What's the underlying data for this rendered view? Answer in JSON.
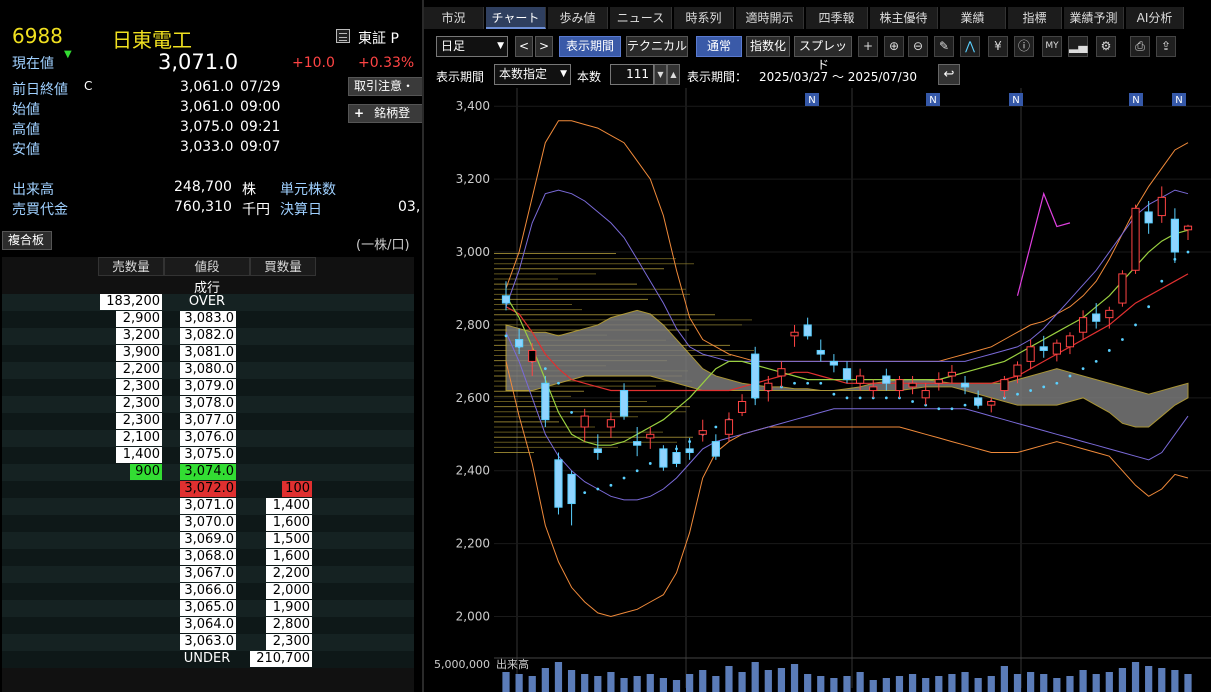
{
  "stock": {
    "code": "6988",
    "name": "日東電工",
    "market": "東証 P",
    "current_label": "現在値",
    "current_arrow": "▼",
    "current_price": "3,071.0",
    "change": "+10.0",
    "change_pct": "+0.33%"
  },
  "summary": [
    {
      "label": "前日終値",
      "flag": "C",
      "value": "3,061.0",
      "time": "07/29"
    },
    {
      "label": "始値",
      "flag": "",
      "value": "3,061.0",
      "time": "09:00"
    },
    {
      "label": "高値",
      "flag": "",
      "value": "3,075.0",
      "time": "09:21"
    },
    {
      "label": "安値",
      "flag": "",
      "value": "3,033.0",
      "time": "09:07"
    }
  ],
  "volume": {
    "label": "出来高",
    "value": "248,700",
    "unit": "株",
    "unit_label": "単元株数"
  },
  "turnover": {
    "label": "売買代金",
    "value": "760,310",
    "unit": "千円",
    "settle_label": "決算日",
    "settle_value": "03,"
  },
  "side_buttons": {
    "caution": "取引注意・",
    "register": "銘柄登",
    "plus": "+"
  },
  "board": {
    "title": "複合板",
    "unit_note": "(一株/口)",
    "headers": [
      "売数量",
      "値段",
      "買数量"
    ],
    "market_order": "成行",
    "rows": [
      {
        "sell": "183,200",
        "price": "OVER",
        "buy": ""
      },
      {
        "sell": "2,900",
        "price": "3,083.0",
        "buy": ""
      },
      {
        "sell": "3,200",
        "price": "3,082.0",
        "buy": ""
      },
      {
        "sell": "3,900",
        "price": "3,081.0",
        "buy": ""
      },
      {
        "sell": "2,200",
        "price": "3,080.0",
        "buy": ""
      },
      {
        "sell": "2,300",
        "price": "3,079.0",
        "buy": ""
      },
      {
        "sell": "2,300",
        "price": "3,078.0",
        "buy": ""
      },
      {
        "sell": "2,300",
        "price": "3,077.0",
        "buy": ""
      },
      {
        "sell": "2,100",
        "price": "3,076.0",
        "buy": ""
      },
      {
        "sell": "1,400",
        "price": "3,075.0",
        "buy": ""
      },
      {
        "sell": "900",
        "price": "3,074.0",
        "buy": ""
      },
      {
        "sell": "",
        "price": "3,072.0",
        "buy": "100"
      },
      {
        "sell": "",
        "price": "3,071.0",
        "buy": "1,400"
      },
      {
        "sell": "",
        "price": "3,070.0",
        "buy": "1,600"
      },
      {
        "sell": "",
        "price": "3,069.0",
        "buy": "1,500"
      },
      {
        "sell": "",
        "price": "3,068.0",
        "buy": "1,600"
      },
      {
        "sell": "",
        "price": "3,067.0",
        "buy": "2,200"
      },
      {
        "sell": "",
        "price": "3,066.0",
        "buy": "2,000"
      },
      {
        "sell": "",
        "price": "3,065.0",
        "buy": "1,900"
      },
      {
        "sell": "",
        "price": "3,064.0",
        "buy": "2,800"
      },
      {
        "sell": "",
        "price": "3,063.0",
        "buy": "2,300"
      },
      {
        "sell": "",
        "price": "UNDER",
        "buy": "210,700"
      }
    ]
  },
  "tabs": [
    "市況",
    "チャート",
    "歩み値",
    "ニュース",
    "時系列",
    "適時開示",
    "四季報",
    "株主優待",
    "業績",
    "指標",
    "業績予測",
    "AI分析"
  ],
  "active_tab": "チャート",
  "toolbar": {
    "period_select": "日足",
    "prev": "<",
    "next": ">",
    "display_period": "表示期間",
    "technical": "テクニカル",
    "normal": "通常",
    "index": "指数化",
    "spread": "スプレッド"
  },
  "period_bar": {
    "label": "表示期間",
    "mode": "本数指定",
    "count_label": "本数",
    "count": "111",
    "range_label": "表示期間：",
    "range": "2025/03/27 ～ 2025/07/30"
  },
  "news_marker": "N",
  "volume_label": "出来高",
  "volume_tick": "5,000,000",
  "colors": {
    "accent": "#3a5aa8",
    "up": "#ff4444",
    "down": "#5ad0ff",
    "bid_green": "#33dd33",
    "ask_red": "#e03030"
  },
  "chart_data": {
    "type": "candlestick",
    "title": "",
    "xlabel": "",
    "ylabel": "",
    "ylim": [
      1900,
      3450
    ],
    "yticks": [
      "3,400",
      "3,200",
      "3,000",
      "2,800",
      "2,600",
      "2,400",
      "2,200",
      "2,000"
    ],
    "x_range": [
      "2025/03/27",
      "2025/07/30"
    ],
    "candles": [
      {
        "o": 2880,
        "h": 2920,
        "l": 2840,
        "c": 2860,
        "d": 1
      },
      {
        "o": 2760,
        "h": 2790,
        "l": 2720,
        "c": 2740,
        "d": 1
      },
      {
        "o": 2700,
        "h": 2750,
        "l": 2660,
        "c": 2730,
        "d": 0
      },
      {
        "o": 2640,
        "h": 2660,
        "l": 2520,
        "c": 2540,
        "d": 1
      },
      {
        "o": 2430,
        "h": 2450,
        "l": 2280,
        "c": 2300,
        "d": 1
      },
      {
        "o": 2390,
        "h": 2400,
        "l": 2250,
        "c": 2310,
        "d": 1
      },
      {
        "o": 2520,
        "h": 2570,
        "l": 2480,
        "c": 2550,
        "d": 0
      },
      {
        "o": 2460,
        "h": 2500,
        "l": 2430,
        "c": 2450,
        "d": 1
      },
      {
        "o": 2520,
        "h": 2560,
        "l": 2490,
        "c": 2540,
        "d": 0
      },
      {
        "o": 2620,
        "h": 2640,
        "l": 2540,
        "c": 2550,
        "d": 1
      },
      {
        "o": 2480,
        "h": 2520,
        "l": 2440,
        "c": 2470,
        "d": 1
      },
      {
        "o": 2490,
        "h": 2520,
        "l": 2460,
        "c": 2500,
        "d": 0
      },
      {
        "o": 2460,
        "h": 2470,
        "l": 2400,
        "c": 2410,
        "d": 1
      },
      {
        "o": 2450,
        "h": 2470,
        "l": 2410,
        "c": 2420,
        "d": 1
      },
      {
        "o": 2460,
        "h": 2490,
        "l": 2430,
        "c": 2450,
        "d": 1
      },
      {
        "o": 2500,
        "h": 2540,
        "l": 2480,
        "c": 2510,
        "d": 0
      },
      {
        "o": 2480,
        "h": 2500,
        "l": 2430,
        "c": 2440,
        "d": 1
      },
      {
        "o": 2500,
        "h": 2560,
        "l": 2480,
        "c": 2540,
        "d": 0
      },
      {
        "o": 2560,
        "h": 2610,
        "l": 2550,
        "c": 2590,
        "d": 0
      },
      {
        "o": 2720,
        "h": 2740,
        "l": 2580,
        "c": 2600,
        "d": 1
      },
      {
        "o": 2620,
        "h": 2660,
        "l": 2590,
        "c": 2640,
        "d": 0
      },
      {
        "o": 2660,
        "h": 2700,
        "l": 2630,
        "c": 2680,
        "d": 0
      },
      {
        "o": 2770,
        "h": 2800,
        "l": 2740,
        "c": 2780,
        "d": 0
      },
      {
        "o": 2800,
        "h": 2820,
        "l": 2760,
        "c": 2770,
        "d": 1
      },
      {
        "o": 2730,
        "h": 2760,
        "l": 2700,
        "c": 2720,
        "d": 1
      },
      {
        "o": 2700,
        "h": 2720,
        "l": 2670,
        "c": 2690,
        "d": 1
      },
      {
        "o": 2680,
        "h": 2700,
        "l": 2640,
        "c": 2650,
        "d": 1
      },
      {
        "o": 2640,
        "h": 2680,
        "l": 2620,
        "c": 2660,
        "d": 0
      },
      {
        "o": 2620,
        "h": 2650,
        "l": 2600,
        "c": 2630,
        "d": 0
      },
      {
        "o": 2660,
        "h": 2680,
        "l": 2620,
        "c": 2640,
        "d": 1
      },
      {
        "o": 2620,
        "h": 2660,
        "l": 2600,
        "c": 2650,
        "d": 0
      },
      {
        "o": 2630,
        "h": 2660,
        "l": 2610,
        "c": 2640,
        "d": 0
      },
      {
        "o": 2600,
        "h": 2640,
        "l": 2580,
        "c": 2620,
        "d": 0
      },
      {
        "o": 2640,
        "h": 2670,
        "l": 2620,
        "c": 2650,
        "d": 0
      },
      {
        "o": 2660,
        "h": 2690,
        "l": 2640,
        "c": 2670,
        "d": 0
      },
      {
        "o": 2640,
        "h": 2660,
        "l": 2610,
        "c": 2630,
        "d": 1
      },
      {
        "o": 2600,
        "h": 2620,
        "l": 2570,
        "c": 2580,
        "d": 1
      },
      {
        "o": 2580,
        "h": 2600,
        "l": 2560,
        "c": 2590,
        "d": 0
      },
      {
        "o": 2620,
        "h": 2660,
        "l": 2600,
        "c": 2650,
        "d": 0
      },
      {
        "o": 2660,
        "h": 2700,
        "l": 2640,
        "c": 2690,
        "d": 0
      },
      {
        "o": 2700,
        "h": 2760,
        "l": 2680,
        "c": 2740,
        "d": 0
      },
      {
        "o": 2740,
        "h": 2770,
        "l": 2710,
        "c": 2730,
        "d": 1
      },
      {
        "o": 2720,
        "h": 2760,
        "l": 2700,
        "c": 2750,
        "d": 0
      },
      {
        "o": 2740,
        "h": 2780,
        "l": 2720,
        "c": 2770,
        "d": 0
      },
      {
        "o": 2780,
        "h": 2840,
        "l": 2760,
        "c": 2820,
        "d": 0
      },
      {
        "o": 2830,
        "h": 2860,
        "l": 2790,
        "c": 2810,
        "d": 1
      },
      {
        "o": 2820,
        "h": 2850,
        "l": 2790,
        "c": 2840,
        "d": 0
      },
      {
        "o": 2860,
        "h": 2950,
        "l": 2850,
        "c": 2940,
        "d": 0
      },
      {
        "o": 2950,
        "h": 3130,
        "l": 2940,
        "c": 3120,
        "d": 0
      },
      {
        "o": 3110,
        "h": 3140,
        "l": 3050,
        "c": 3080,
        "d": 1
      },
      {
        "o": 3100,
        "h": 3180,
        "l": 3080,
        "c": 3150,
        "d": 0
      },
      {
        "o": 3090,
        "h": 3120,
        "l": 2970,
        "c": 3000,
        "d": 1
      },
      {
        "o": 3061,
        "h": 3075,
        "l": 3033,
        "c": 3071,
        "d": 0
      }
    ]
  }
}
